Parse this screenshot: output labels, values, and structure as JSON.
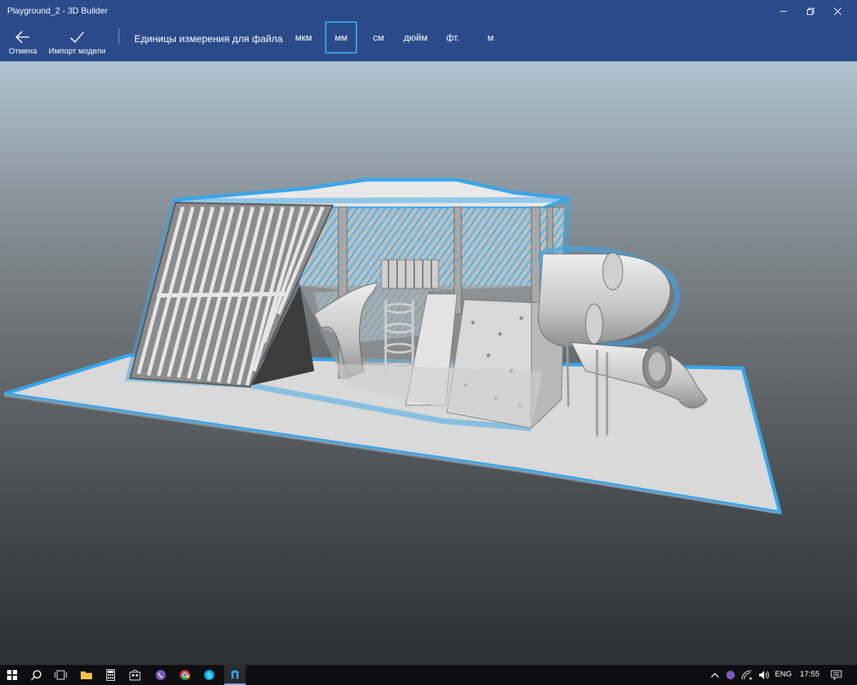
{
  "window": {
    "title": "Playground_2 - 3D Builder"
  },
  "toolbar": {
    "cancel_label": "Отмена",
    "import_label": "Импорт модели",
    "units_label": "Единицы измерения для файла",
    "units": [
      "мкм",
      "мм",
      "см",
      "дюйм",
      "фт.",
      "м"
    ],
    "selected_unit": "мм"
  },
  "colors": {
    "accent": "#3aa5e8",
    "titlebar": "#2b4a8a",
    "model": "#d6d6d6"
  },
  "taskbar": {
    "apps": [
      "start-icon",
      "search-icon",
      "task-view-icon",
      "file-explorer-icon",
      "calculator-icon",
      "store-icon",
      "viber-icon",
      "chrome-icon",
      "skype-icon",
      "3d-builder-icon"
    ],
    "language": "ENG",
    "time": "17:55"
  }
}
